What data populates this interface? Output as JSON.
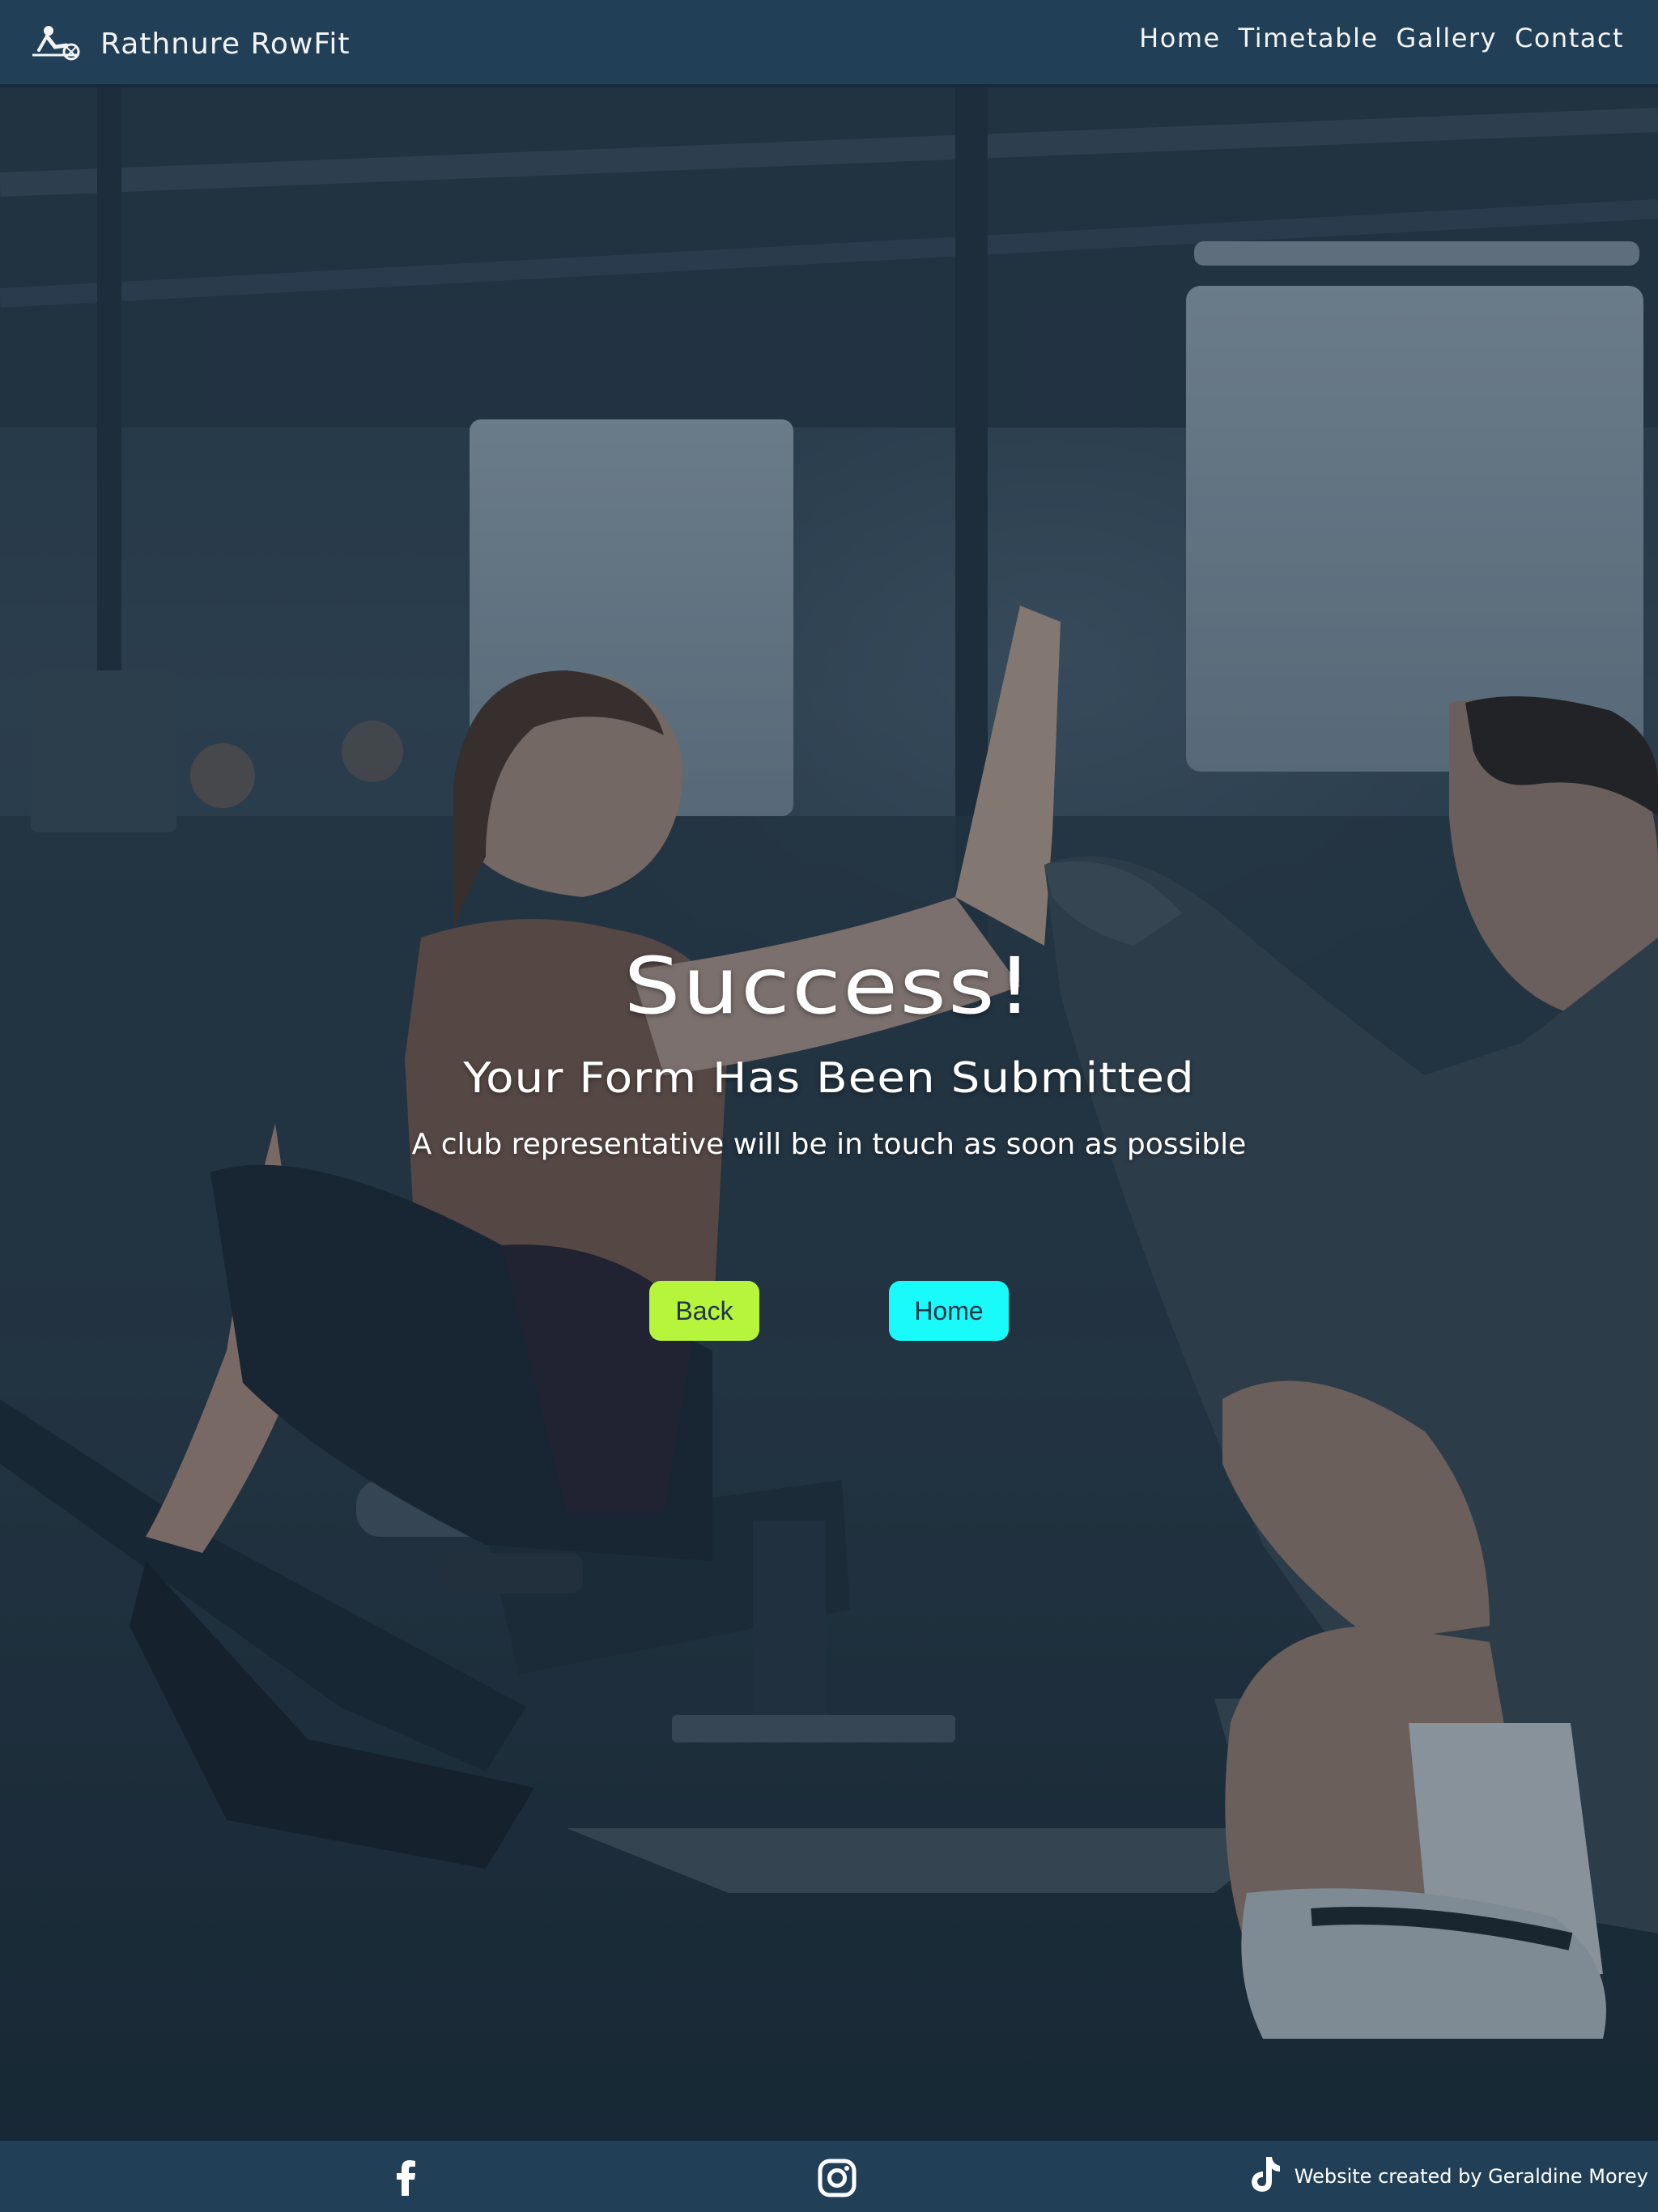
{
  "header": {
    "brand_name": "Rathnure RowFit",
    "nav": [
      {
        "label": "Home"
      },
      {
        "label": "Timetable"
      },
      {
        "label": "Gallery"
      },
      {
        "label": "Contact"
      }
    ]
  },
  "hero": {
    "title": "Success!",
    "subtitle": "Your Form Has Been Submitted",
    "text": "A club representative will be in touch as soon as possible",
    "back_button": "Back",
    "home_button": "Home"
  },
  "footer": {
    "icons": [
      "facebook-icon",
      "instagram-icon",
      "tiktok-icon"
    ],
    "credit": "Website created by Geraldine Morey"
  },
  "colors": {
    "header_bg": "#213f57",
    "back_button_bg": "#b6f53b",
    "home_button_bg": "#18fbfa",
    "button_text": "#233447",
    "text": "#ffffff"
  }
}
